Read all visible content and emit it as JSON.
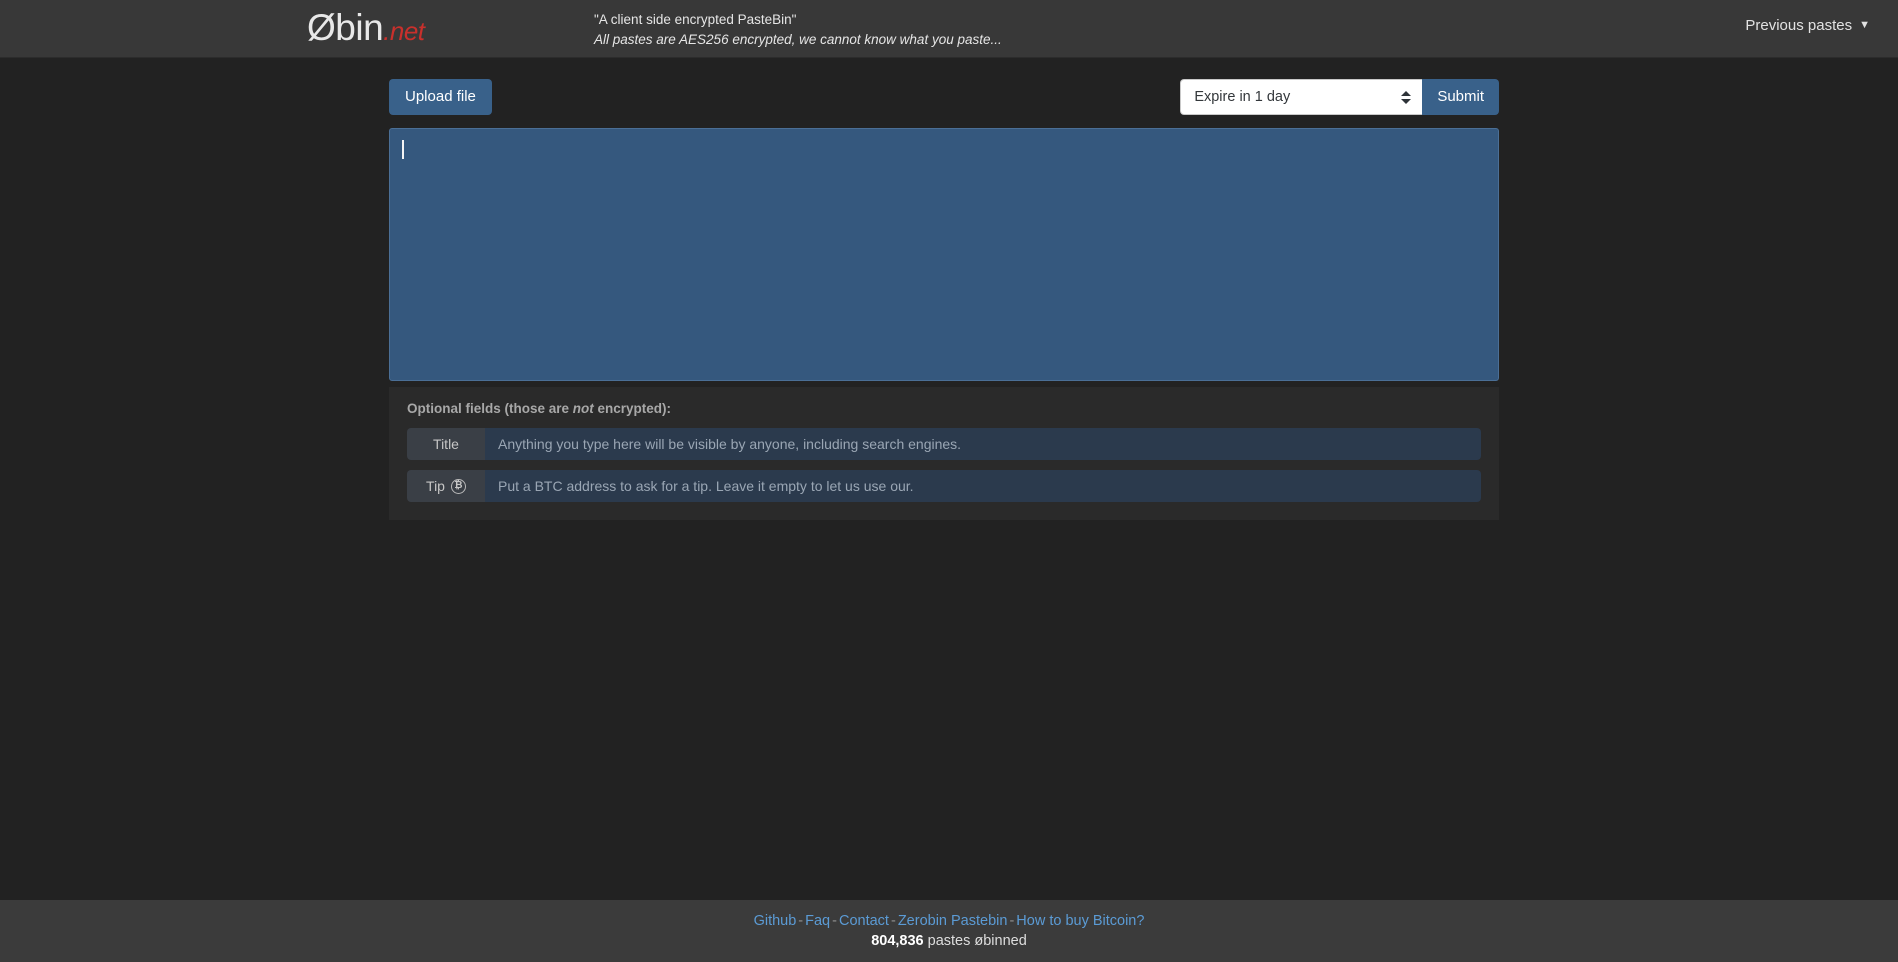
{
  "header": {
    "logo_main": "Øbin",
    "logo_suffix": ".net",
    "tagline_line1": "\"A client side encrypted PasteBin\"",
    "tagline_line2": "All pastes are AES256 encrypted, we cannot know what you paste...",
    "previous_pastes_label": "Previous pastes",
    "caret_glyph": "▼"
  },
  "toolbar": {
    "upload_label": "Upload file",
    "expire_selected": "Expire in 1 day",
    "submit_label": "Submit"
  },
  "paste": {
    "value": "",
    "placeholder": ""
  },
  "optional": {
    "heading_before": "Optional fields (those are ",
    "heading_em": "not",
    "heading_after": " encrypted):",
    "fields": [
      {
        "label": "Title",
        "icon": "",
        "value": "",
        "placeholder": "Anything you type here will be visible by anyone, including search engines."
      },
      {
        "label": "Tip",
        "icon": "₿",
        "value": "",
        "placeholder": "Put a BTC address to ask for a tip. Leave it empty to let us use our."
      }
    ]
  },
  "footer": {
    "links": [
      "Github",
      "Faq",
      "Contact",
      "Zerobin Pastebin",
      "How to buy Bitcoin?"
    ],
    "separator": "-",
    "count": "804,836",
    "count_suffix": " pastes øbinned"
  },
  "colors": {
    "page_bg": "#222222",
    "header_bg": "#383838",
    "footer_bg": "#3b3b3b",
    "panel_bg": "#2a2a2a",
    "accent_blue": "#39618a",
    "textarea_blue": "#35587e",
    "input_blue": "#2b3a4d",
    "link_blue": "#5b9bd5",
    "logo_red": "#c9302c"
  }
}
